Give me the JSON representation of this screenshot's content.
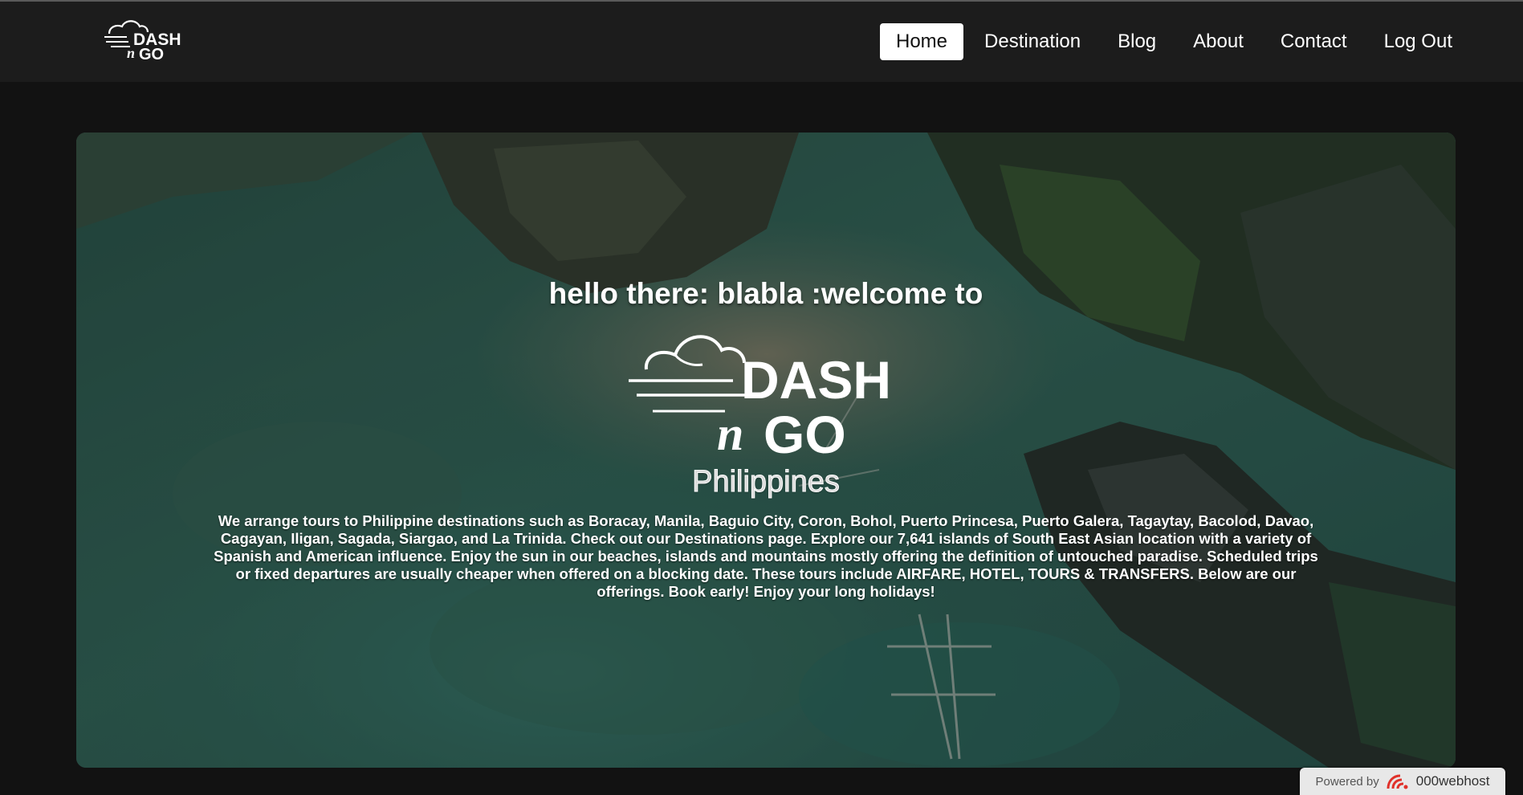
{
  "navbar": {
    "logo_alt": "DASH n GO",
    "links": [
      {
        "label": "Home",
        "active": true
      },
      {
        "label": "Destination",
        "active": false
      },
      {
        "label": "Blog",
        "active": false
      },
      {
        "label": "About",
        "active": false
      },
      {
        "label": "Contact",
        "active": false
      },
      {
        "label": "Log Out",
        "active": false
      }
    ]
  },
  "hero": {
    "greeting": "hello there: blabla :welcome to",
    "logo_top": "DASH",
    "logo_bottom_script": "n",
    "logo_bottom": "GO",
    "country": "Philippines",
    "description": "We arrange tours to Philippine destinations such as Boracay, Manila, Baguio City, Coron, Bohol, Puerto Princesa, Puerto Galera, Tagaytay, Bacolod, Davao, Cagayan, Iligan, Sagada, Siargao, and La Trinida. Check out our Destinations page. Explore our 7,641 islands of South East Asian location with a variety of Spanish and American influence. Enjoy the sun in our beaches, islands and mountains mostly offering the definition of untouched paradise. Scheduled trips or fixed departures are usually cheaper when offered on a blocking date. These tours include AIRFARE, HOTEL, TOURS & TRANSFERS. Below are our offerings. Book early! Enjoy your long holidays!"
  },
  "footer_badge": {
    "powered_by": "Powered by",
    "brand": "000webhost"
  },
  "colors": {
    "page_bg": "#121212",
    "navbar_bg": "#1c1c1c",
    "active_nav_bg": "#ffffff",
    "badge_bg": "#e8e8e8",
    "badge_icon": "#e0312a"
  }
}
